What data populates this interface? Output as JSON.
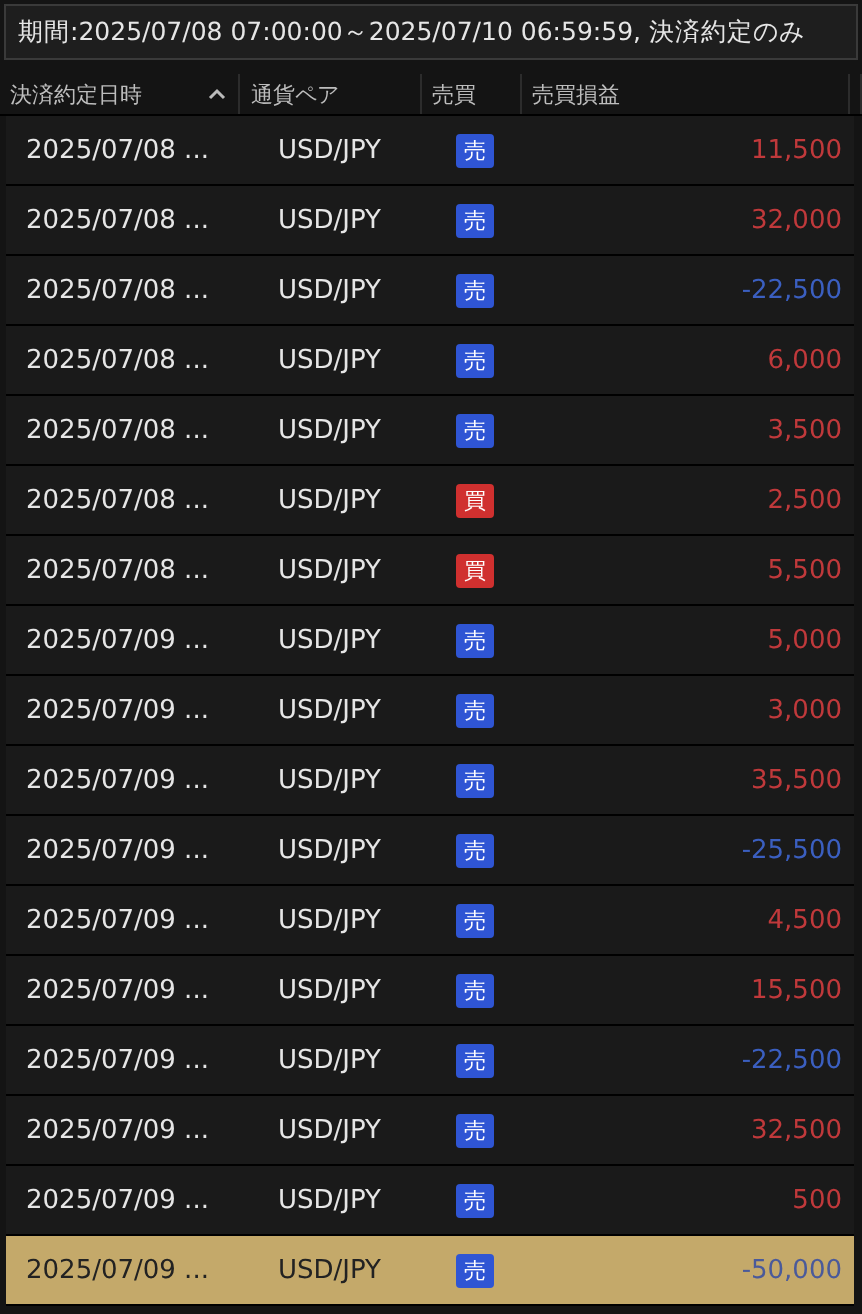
{
  "filter": "期間:2025/07/08 07:00:00～2025/07/10 06:59:59, 決済約定のみ",
  "columns": [
    {
      "label": "決済約定日時",
      "sorted": true
    },
    {
      "label": "通貨ペア",
      "sorted": false
    },
    {
      "label": "売買",
      "sorted": false
    },
    {
      "label": "売買損益",
      "sorted": false
    }
  ],
  "rows": [
    {
      "date": "2025/07/08 ...",
      "pair": "USD/JPY",
      "side": {
        "label": "売",
        "kind": "sell"
      },
      "profit": "11,500",
      "color": "#c0393b",
      "selected": false
    },
    {
      "date": "2025/07/08 ...",
      "pair": "USD/JPY",
      "side": {
        "label": "売",
        "kind": "sell"
      },
      "profit": "32,000",
      "color": "#c0393b",
      "selected": false
    },
    {
      "date": "2025/07/08 ...",
      "pair": "USD/JPY",
      "side": {
        "label": "売",
        "kind": "sell"
      },
      "profit": "-22,500",
      "color": "#3b5fc0",
      "selected": false
    },
    {
      "date": "2025/07/08 ...",
      "pair": "USD/JPY",
      "side": {
        "label": "売",
        "kind": "sell"
      },
      "profit": "6,000",
      "color": "#c0393b",
      "selected": false
    },
    {
      "date": "2025/07/08 ...",
      "pair": "USD/JPY",
      "side": {
        "label": "売",
        "kind": "sell"
      },
      "profit": "3,500",
      "color": "#c0393b",
      "selected": false
    },
    {
      "date": "2025/07/08 ...",
      "pair": "USD/JPY",
      "side": {
        "label": "買",
        "kind": "buy"
      },
      "profit": "2,500",
      "color": "#c0393b",
      "selected": false
    },
    {
      "date": "2025/07/08 ...",
      "pair": "USD/JPY",
      "side": {
        "label": "買",
        "kind": "buy"
      },
      "profit": "5,500",
      "color": "#c0393b",
      "selected": false
    },
    {
      "date": "2025/07/09 ...",
      "pair": "USD/JPY",
      "side": {
        "label": "売",
        "kind": "sell"
      },
      "profit": "5,000",
      "color": "#c0393b",
      "selected": false
    },
    {
      "date": "2025/07/09 ...",
      "pair": "USD/JPY",
      "side": {
        "label": "売",
        "kind": "sell"
      },
      "profit": "3,000",
      "color": "#c0393b",
      "selected": false
    },
    {
      "date": "2025/07/09 ...",
      "pair": "USD/JPY",
      "side": {
        "label": "売",
        "kind": "sell"
      },
      "profit": "35,500",
      "color": "#c0393b",
      "selected": false
    },
    {
      "date": "2025/07/09 ...",
      "pair": "USD/JPY",
      "side": {
        "label": "売",
        "kind": "sell"
      },
      "profit": "-25,500",
      "color": "#3b5fc0",
      "selected": false
    },
    {
      "date": "2025/07/09 ...",
      "pair": "USD/JPY",
      "side": {
        "label": "売",
        "kind": "sell"
      },
      "profit": "4,500",
      "color": "#c0393b",
      "selected": false
    },
    {
      "date": "2025/07/09 ...",
      "pair": "USD/JPY",
      "side": {
        "label": "売",
        "kind": "sell"
      },
      "profit": "15,500",
      "color": "#c0393b",
      "selected": false
    },
    {
      "date": "2025/07/09 ...",
      "pair": "USD/JPY",
      "side": {
        "label": "売",
        "kind": "sell"
      },
      "profit": "-22,500",
      "color": "#3b5fc0",
      "selected": false
    },
    {
      "date": "2025/07/09 ...",
      "pair": "USD/JPY",
      "side": {
        "label": "売",
        "kind": "sell"
      },
      "profit": "32,500",
      "color": "#c0393b",
      "selected": false
    },
    {
      "date": "2025/07/09 ...",
      "pair": "USD/JPY",
      "side": {
        "label": "売",
        "kind": "sell"
      },
      "profit": "500",
      "color": "#c0393b",
      "selected": false
    },
    {
      "date": "2025/07/09 ...",
      "pair": "USD/JPY",
      "side": {
        "label": "売",
        "kind": "sell"
      },
      "profit": "-50,000",
      "color": "#4a5a9a",
      "selected": true
    }
  ]
}
